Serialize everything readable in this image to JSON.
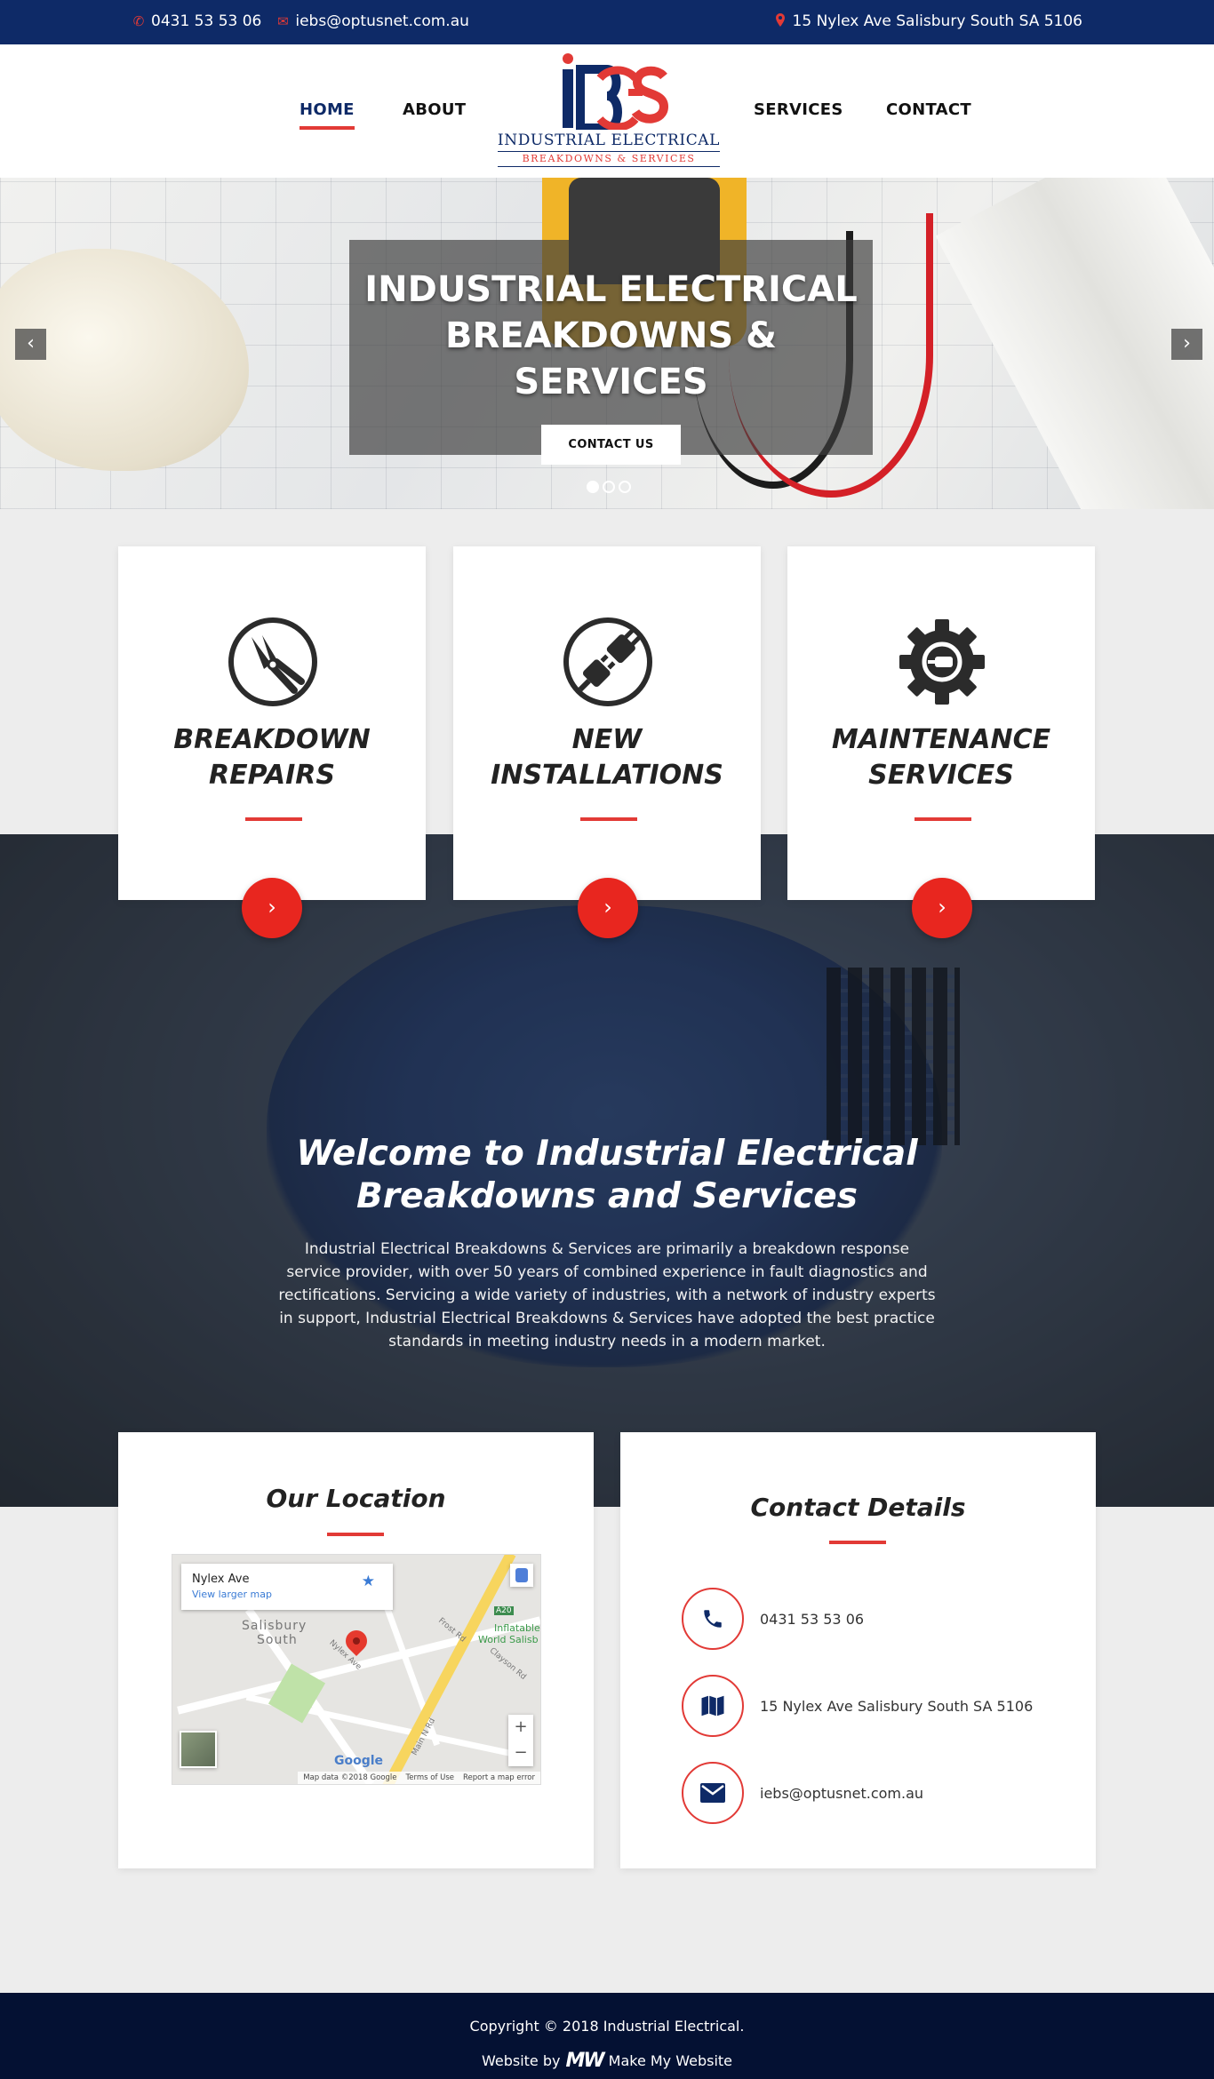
{
  "topbar": {
    "phone": "0431 53 53 06",
    "email": "iebs@optusnet.com.au",
    "address": "15 Nylex Ave Salisbury South SA 5106"
  },
  "nav": {
    "home": "HOME",
    "about": "ABOUT",
    "services": "SERVICES",
    "contact": "CONTACT"
  },
  "logo": {
    "monogram": "IEBS",
    "line1": "INDUSTRIAL ELECTRICAL",
    "line2": "BREAKDOWNS & SERVICES"
  },
  "hero": {
    "title_line1": "INDUSTRIAL ELECTRICAL",
    "title_line2": "BREAKDOWNS & SERVICES",
    "cta": "CONTACT US",
    "prev": "‹",
    "next": "›"
  },
  "services": [
    {
      "line1": "BREAKDOWN",
      "line2": "REPAIRS",
      "icon": "pliers-icon"
    },
    {
      "line1": "NEW",
      "line2": "INSTALLATIONS",
      "icon": "plug-icon"
    },
    {
      "line1": "MAINTENANCE",
      "line2": "SERVICES",
      "icon": "gear-plug-icon"
    }
  ],
  "welcome": {
    "title_line1": "Welcome to Industrial Electrical",
    "title_line2": "Breakdowns and Services",
    "body": "Industrial Electrical Breakdowns & Services are primarily a breakdown response service provider, with over 50 years of combined experience in fault diagnostics and rectifications. Servicing a wide variety of industries, with a network of industry experts in support, Industrial Electrical Breakdowns & Services have adopted the best practice standards in meeting industry needs in a modern market."
  },
  "location": {
    "title": "Our Location",
    "map_place": "Nylex Ave",
    "map_link": "View larger map",
    "map_labels": [
      "Salisbury",
      "South",
      "Frost Rd",
      "Clayson Rd",
      "Main N Rd",
      "Inflatable",
      "World Salisb",
      "A20",
      "Nylex Ave"
    ],
    "map_attrib": [
      "Map data ©2018 Google",
      "Terms of Use",
      "Report a map error"
    ],
    "map_brand": "Google"
  },
  "contact": {
    "title": "Contact Details",
    "phone": "0431 53 53 06",
    "address": "15 Nylex Ave Salisbury South SA 5106",
    "email": "iebs@optusnet.com.au"
  },
  "footer": {
    "copyright": "Copyright © 2018 Industrial Electrical.",
    "website_by": "Website by",
    "maker_logo": "MW",
    "maker": "Make My Website"
  },
  "colors": {
    "navy": "#0e2a67",
    "red": "#e23a36",
    "footer": "#041133"
  }
}
